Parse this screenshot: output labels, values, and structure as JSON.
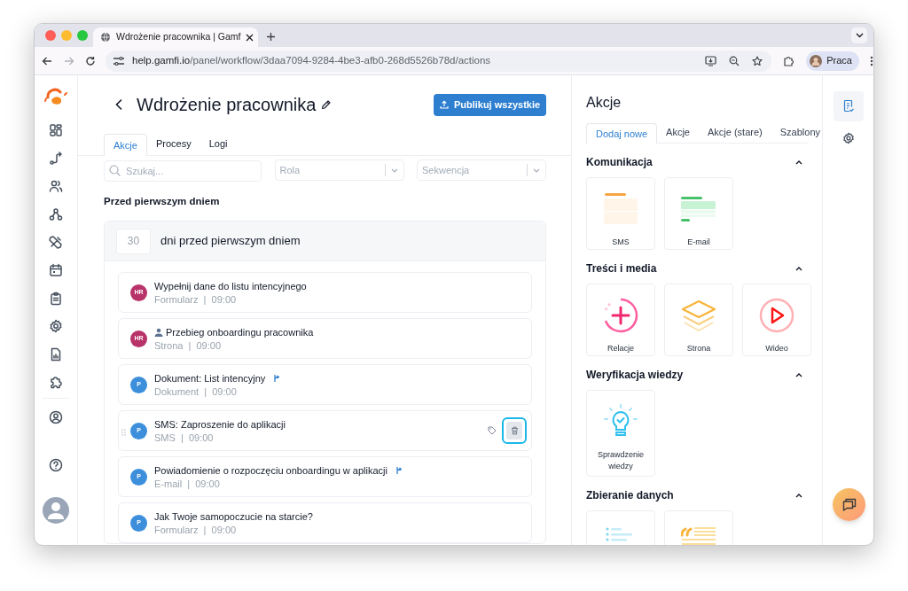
{
  "browser": {
    "tab_title": "Wdrożenie pracownika | Gamf",
    "url_host": "help.gamfi.io",
    "url_path": "/panel/workflow/3daa7094-9284-4be3-afb0-268d5526b78d/actions",
    "forward_enabled": false,
    "profile": "Praca"
  },
  "header": {
    "title": "Wdrożenie pracownika",
    "publish_button": "Publikuj wszystkie"
  },
  "tabs": [
    {
      "label": "Akcje",
      "selected": true
    },
    {
      "label": "Procesy",
      "selected": false
    },
    {
      "label": "Logi",
      "selected": false
    }
  ],
  "filters": {
    "search_placeholder": "Szukaj...",
    "role_placeholder": "Rola",
    "sequence_placeholder": "Sekwencja"
  },
  "section_title": "Przed pierwszym dniem",
  "group": {
    "days": "30",
    "label": "dni przed pierwszym dniem"
  },
  "actions": [
    {
      "avatar": "HR",
      "color": "#b8336a",
      "title": "Wypełnij dane do listu intencyjnego",
      "meta": "Formularz  |  09:00",
      "person_icon": false,
      "branched": false,
      "hovered": false
    },
    {
      "avatar": "HR",
      "color": "#b8336a",
      "title": "Przebieg onboardingu pracownika",
      "meta": "Strona  |  09:00",
      "person_icon": true,
      "branched": false,
      "hovered": false
    },
    {
      "avatar": "P",
      "color": "#3d8fdc",
      "title": "Dokument: List intencyjny",
      "meta": "Dokument  |  09:00",
      "person_icon": false,
      "branched": true,
      "hovered": false
    },
    {
      "avatar": "P",
      "color": "#3d8fdc",
      "title": "SMS: Zaproszenie do aplikacji",
      "meta": "SMS  |  09:00",
      "person_icon": false,
      "branched": false,
      "hovered": true
    },
    {
      "avatar": "P",
      "color": "#3d8fdc",
      "title": "Powiadomienie o rozpoczęciu onboardingu w aplikacji",
      "meta": "E-mail  |  09:00",
      "person_icon": false,
      "branched": true,
      "hovered": false
    },
    {
      "avatar": "P",
      "color": "#3d8fdc",
      "title": "Jak Twoje samopoczucie na starcie?",
      "meta": "Formularz  |  09:00",
      "person_icon": false,
      "branched": false,
      "hovered": false
    }
  ],
  "panel": {
    "title": "Akcje",
    "tabs": [
      {
        "label": "Dodaj nowe",
        "selected": true
      },
      {
        "label": "Akcje",
        "selected": false
      },
      {
        "label": "Akcje (stare)",
        "selected": false
      },
      {
        "label": "Szablony",
        "selected": false
      }
    ],
    "sections": [
      {
        "title": "Komunikacja",
        "expanded": true,
        "tiles": [
          {
            "kind": "sms",
            "label": "SMS"
          },
          {
            "kind": "email",
            "label": "E-mail"
          }
        ]
      },
      {
        "title": "Treści i media",
        "expanded": true,
        "tiles": [
          {
            "kind": "relacje",
            "label": "Relacje"
          },
          {
            "kind": "strona",
            "label": "Strona"
          },
          {
            "kind": "wideo",
            "label": "Wideo"
          }
        ]
      },
      {
        "title": "Weryfikacja wiedzy",
        "expanded": true,
        "tiles": [
          {
            "kind": "quiz",
            "label": "Sprawdzenie wiedzy"
          }
        ]
      },
      {
        "title": "Zbieranie danych",
        "expanded": true,
        "tiles": [
          {
            "kind": "list"
          },
          {
            "kind": "quote"
          }
        ]
      }
    ]
  }
}
